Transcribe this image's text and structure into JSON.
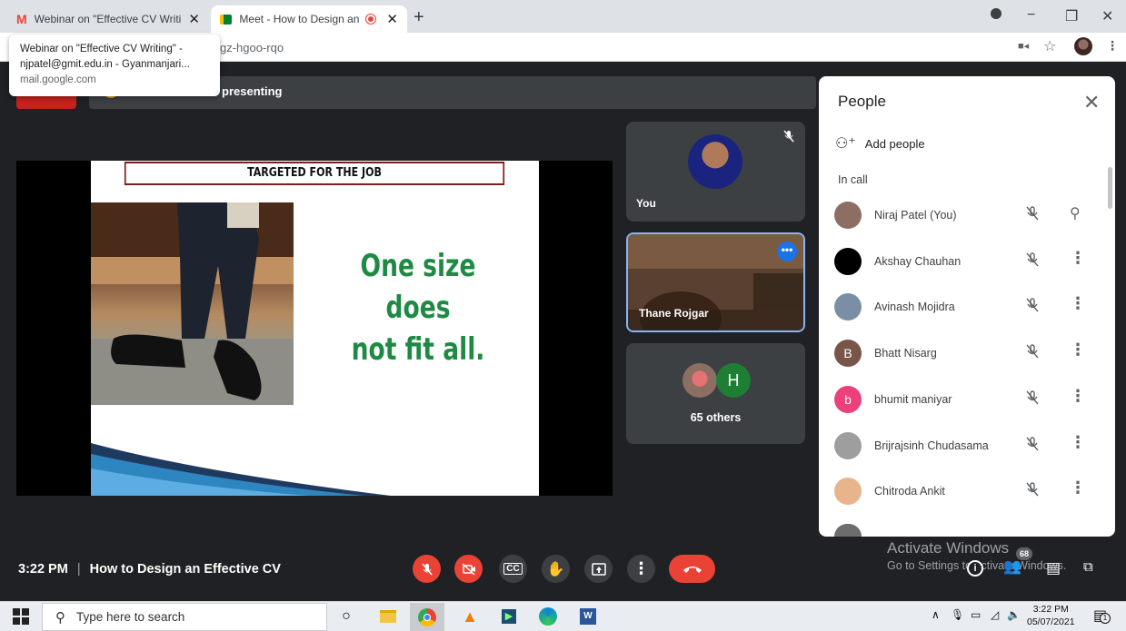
{
  "browser": {
    "tabs": [
      {
        "label": "Webinar on \"Effective CV Writing\" - njpa",
        "favicon": "gmail-icon"
      },
      {
        "label": "Meet - How to Design an Effective CV",
        "favicon": "meet-icon"
      }
    ],
    "url_fragment": "gz-hgoo-rqo",
    "tooltip": {
      "title": "Webinar on \"Effective CV Writing\" -",
      "subtitle": "njpatel@gmit.edu.in - Gyanmanjari...",
      "host": "mail.google.com"
    }
  },
  "meet": {
    "presenting_text": "presenting",
    "slide": {
      "title": "TARGETED FOR THE JOB",
      "line1": "One size does",
      "line2": "not fit all."
    },
    "tiles": {
      "you": "You",
      "pinned": "Thane Rojgar",
      "others": "65 others",
      "others_initial": "H"
    },
    "people": {
      "title": "People",
      "add_label": "Add people",
      "section": "In call",
      "participants": [
        {
          "name": "Niraj Patel (You)",
          "initial": "",
          "color": "#8d6e63"
        },
        {
          "name": "Akshay Chauhan",
          "initial": "",
          "color": "#000000"
        },
        {
          "name": "Avinash Mojidra",
          "initial": "",
          "color": "#7a8fa6"
        },
        {
          "name": "Bhatt Nisarg",
          "initial": "B",
          "color": "#795548"
        },
        {
          "name": "bhumit maniyar",
          "initial": "b",
          "color": "#ec407a"
        },
        {
          "name": "Brijrajsinh Chudasama",
          "initial": "",
          "color": "#9e9e9e"
        },
        {
          "name": "Chitroda Ankit",
          "initial": "",
          "color": "#e8b48c"
        }
      ]
    },
    "bottom": {
      "time": "3:22 PM",
      "separator": "|",
      "meeting_title": "How to Design an Effective CV",
      "participants_badge": "68"
    },
    "watermark": {
      "line1": "Activate Windows",
      "line2": "Go to Settings to activate Windows."
    }
  },
  "taskbar": {
    "search_placeholder": "Type here to search",
    "time": "3:22 PM",
    "date": "05/07/2021",
    "notification_count": "1"
  }
}
